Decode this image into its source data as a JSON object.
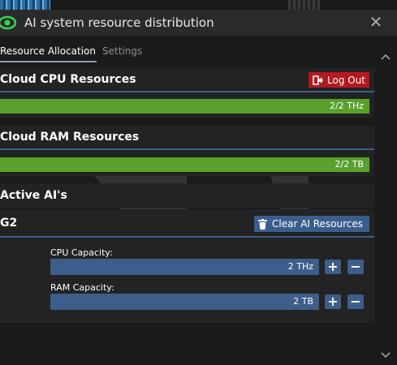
{
  "window": {
    "title": "AI system resource distribution",
    "close_glyph": "✕"
  },
  "tabs": [
    {
      "label": "Resource Allocation",
      "active": true
    },
    {
      "label": "Settings",
      "active": false
    }
  ],
  "cpu": {
    "title": "Cloud CPU Resources",
    "logout_label": "Log Out",
    "bar_text": "2/2 THz",
    "fill_fraction": 1.0
  },
  "ram": {
    "title": "Cloud RAM Resources",
    "bar_text": "2/2 TB",
    "fill_fraction": 1.0
  },
  "active": {
    "title": "Active AI's"
  },
  "ai": {
    "name": "G2",
    "clear_label": "Clear AI Resources",
    "cpu_label": "CPU Capacity:",
    "cpu_value": "2 THz",
    "ram_label": "RAM Capacity:",
    "ram_value": "2 TB",
    "plus": "+",
    "minus": "−"
  },
  "icons": {
    "eye": "eye-icon",
    "close": "close-icon",
    "logout": "logout-icon",
    "trash": "trash-icon",
    "scroll_up": "chevron-up-icon",
    "scroll_down": "chevron-down-icon"
  },
  "colors": {
    "accent_blue": "#3d5e8a",
    "bar_green": "#5aa02c",
    "logout_red": "#b3191f",
    "eye_green": "#39d353"
  }
}
